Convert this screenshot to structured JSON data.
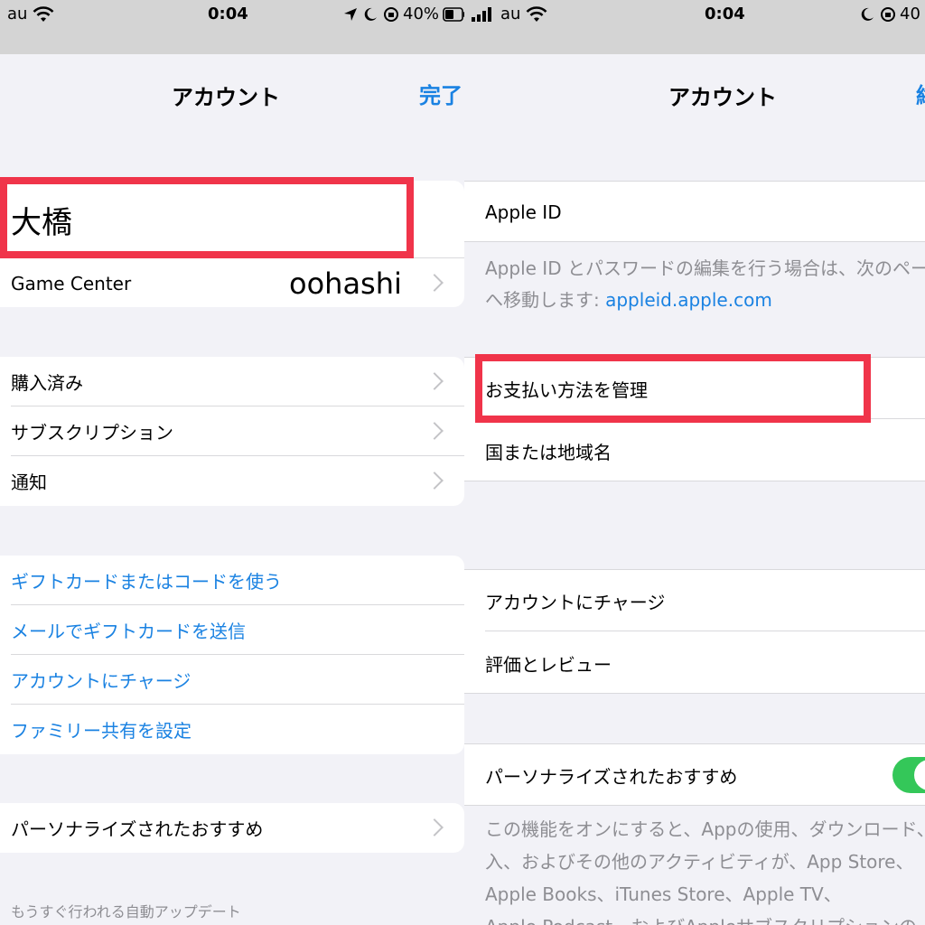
{
  "left": {
    "status": {
      "carrier": "au",
      "time": "0:04",
      "battery": "40%",
      "icons": [
        "wifi-icon",
        "location-icon",
        "moon-icon",
        "rotation-lock-icon",
        "battery-icon"
      ]
    },
    "nav": {
      "title": "アカウント",
      "done": "完了"
    },
    "profile": {
      "name": "大橋"
    },
    "game_center": {
      "label": "Game Center",
      "value": "oohashi"
    },
    "group2": [
      "購入済み",
      "サブスクリプション",
      "通知"
    ],
    "group3": [
      "ギフトカードまたはコードを使う",
      "メールでギフトカードを送信",
      "アカウントにチャージ",
      "ファミリー共有を設定"
    ],
    "personalized": "パーソナライズされたおすすめ",
    "footer": "もうすぐ行われる自動アップデート"
  },
  "right": {
    "status": {
      "carrier": "au",
      "time": "0:04",
      "battery": "40",
      "icons": [
        "signal-icon",
        "wifi-icon",
        "moon-icon",
        "rotation-lock-icon"
      ]
    },
    "nav": {
      "title": "アカウント",
      "done_partial": "終"
    },
    "apple_id": "Apple ID",
    "apple_id_note_1": "Apple ID とパスワードの編集を行う場合は、次のペー",
    "apple_id_note_2_prefix": "へ移動します: ",
    "apple_id_note_2_link": "appleid.apple.com",
    "payment": "お支払い方法を管理",
    "country": "国または地域名",
    "charge": "アカウントにチャージ",
    "ratings": "評価とレビュー",
    "personalized": "パーソナライズされたおすすめ",
    "personalized_on": true,
    "desc_1": "この機能をオンにすると、Appの使用、ダウンロード、",
    "desc_2": "入、およびその他のアクティビティが、App Store、",
    "desc_3": "Apple Books、iTunes Store、Apple TV、",
    "desc_4": "Apple Podcast、およびAppleサブスクリプションの"
  },
  "colors": {
    "accent": "#1a82e2",
    "highlight": "#f0344a",
    "toggle_on": "#34c759",
    "background": "#f2f2f7"
  }
}
